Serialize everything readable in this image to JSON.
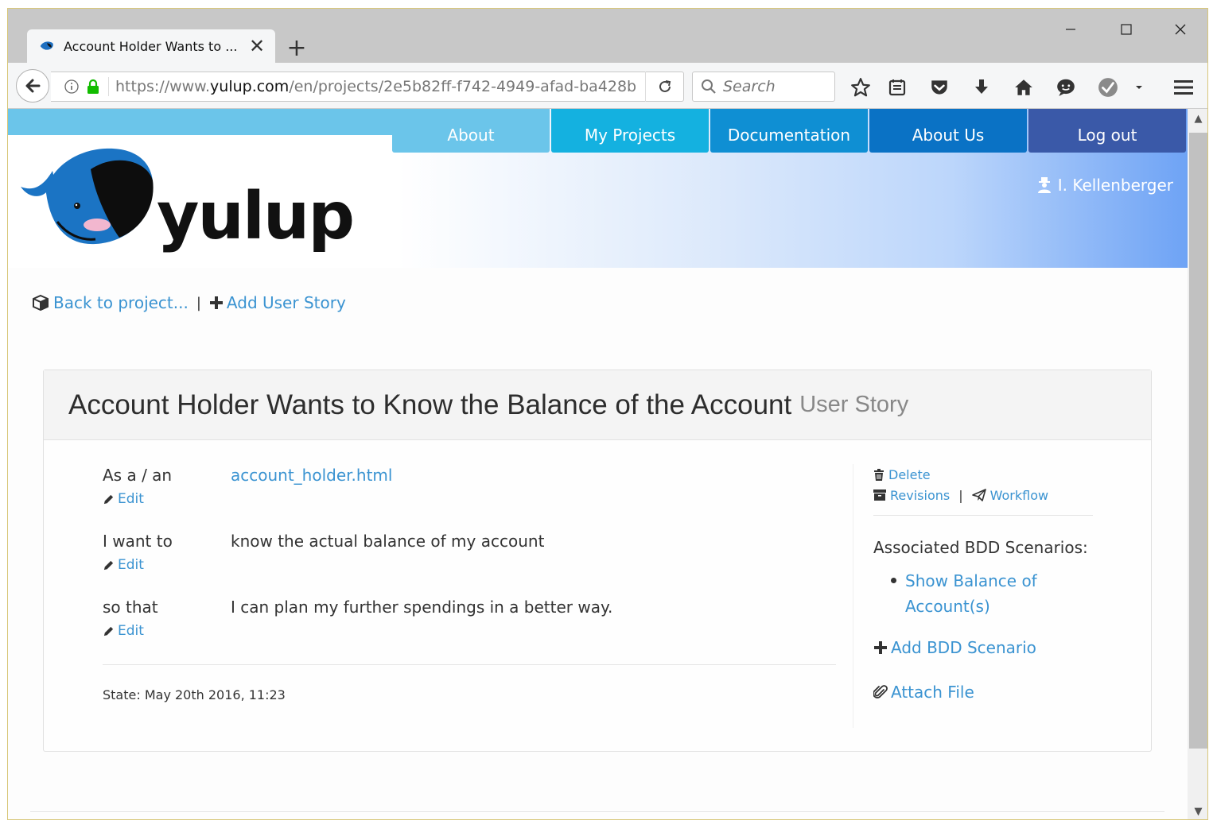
{
  "browser": {
    "tab_title": "Account Holder Wants to ...",
    "url_prefix": "https://www.",
    "url_host": "yulup.com",
    "url_path": "/en/projects/2e5b82ff-f742-4949-afad-ba428b",
    "search_placeholder": "Search"
  },
  "site": {
    "logo_text": "yulup",
    "nav": [
      "About",
      "My Projects",
      "Documentation",
      "About Us",
      "Log out"
    ],
    "nav_colors": [
      "#6bc5ea",
      "#14b1e0",
      "#0f8fd3",
      "#0a72c5",
      "#3a59a8"
    ],
    "user": "I. Kellenberger"
  },
  "crumbs": {
    "back": "Back to project...",
    "separator": "|",
    "add_story": "Add User Story"
  },
  "story": {
    "title": "Account Holder Wants to Know the Balance of the Account",
    "subtitle": "User Story",
    "edit_label": "Edit",
    "rows": [
      {
        "label": "As a / an",
        "value": "account_holder.html"
      },
      {
        "label": "I want to",
        "value": "know the actual balance of my account"
      },
      {
        "label": "so that",
        "value": "I can plan my further spendings in a better way."
      }
    ],
    "state": "State: May 20th 2016, 11:23"
  },
  "sidebar": {
    "delete": "Delete",
    "revisions": "Revisions",
    "separator": "|",
    "workflow": "Workflow",
    "assoc_label": "Associated BDD Scenarios:",
    "scenarios": [
      "Show Balance of Account(s)"
    ],
    "add_scenario": "Add BDD Scenario",
    "attach_file": "Attach File"
  },
  "colors": {
    "link": "#3a93d1",
    "header_bar": "#6bc5ea"
  }
}
